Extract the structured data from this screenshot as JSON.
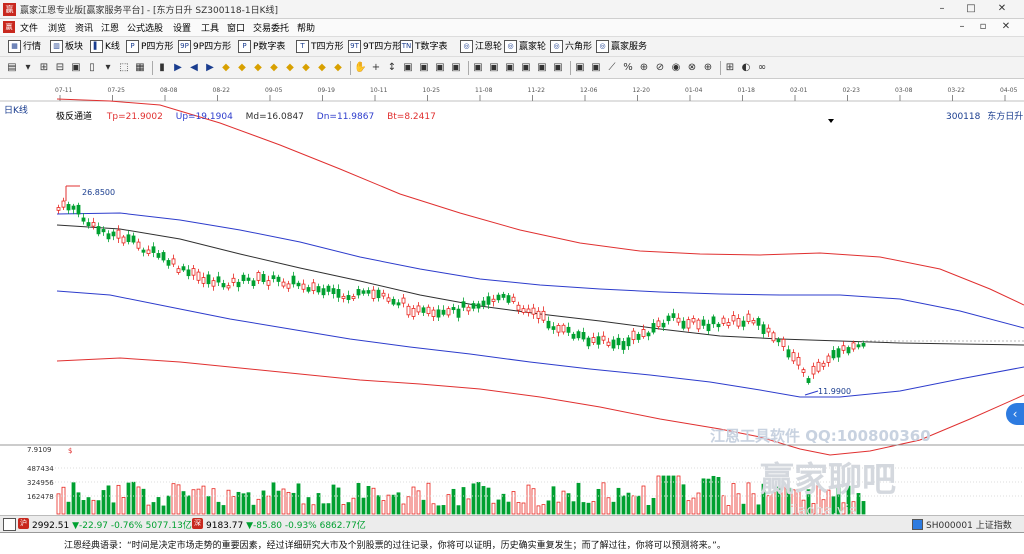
{
  "window": {
    "title": "赢家江恩专业版[赢家服务平台] - [东方日升  SZ300118-1日K线]",
    "logo": "赢"
  },
  "menu": {
    "items": [
      "文件",
      "浏览",
      "资讯",
      "江恩",
      "公式选股",
      "设置",
      "工具",
      "窗口",
      "交易委托",
      "帮助"
    ]
  },
  "toolbar": {
    "items": [
      {
        "icon": "▦",
        "label": "行情"
      },
      {
        "icon": "▥",
        "label": "板块"
      },
      {
        "icon": "▌",
        "label": "K线"
      },
      {
        "icon": "P",
        "label": "P四方形"
      },
      {
        "icon": "9P",
        "label": "9P四方形"
      },
      {
        "icon": "P",
        "label": "P数字表"
      },
      {
        "icon": "T",
        "label": "T四方形"
      },
      {
        "icon": "9T",
        "label": "9T四方形"
      },
      {
        "icon": "TN",
        "label": "T数字表"
      },
      {
        "icon": "◎",
        "label": "江恩轮"
      },
      {
        "icon": "◎",
        "label": "赢家轮"
      },
      {
        "icon": "◎",
        "label": "六角形"
      },
      {
        "icon": "◎",
        "label": "赢家服务"
      }
    ]
  },
  "chart": {
    "period_label": "日K线",
    "indicator_name": "极反通道",
    "tp": "Tp=21.9002",
    "up": "Up=19.1904",
    "md": "Md=16.0847",
    "dn": "Dn=11.9867",
    "bt": "Bt=8.2417",
    "code": "300118",
    "name": "东方日升",
    "high_marker": "26.8500",
    "low_marker": "11.9900",
    "volume_top": "7.9109",
    "volume_unit": "$",
    "volume_ticks": [
      "487434",
      "324956",
      "162478"
    ],
    "dates": [
      "07-11",
      "07-25",
      "08-08",
      "08-22",
      "09-05",
      "09-19",
      "10-11",
      "10-25",
      "11-08",
      "11-22",
      "12-06",
      "12-20",
      "01-04",
      "01-18",
      "02-01",
      "02-23",
      "03-08",
      "03-22",
      "04-05"
    ],
    "watermark1": "江恩工具软件  QQ:100800360",
    "watermark2": "赢家聊吧",
    "watermark3": "jiaoba.yjs"
  },
  "colors": {
    "up": "#e8251e",
    "down": "#00a030",
    "upper_band": "#e03030",
    "mid_band": "#303030",
    "lower_band": "#2d3ccc"
  },
  "chart_data": {
    "type": "candlestick",
    "x_dates": [
      "07-11",
      "07-25",
      "08-08",
      "08-22",
      "09-05",
      "09-19",
      "10-11",
      "10-25",
      "11-08",
      "11-22",
      "12-06",
      "12-20",
      "01-04",
      "01-18",
      "02-01",
      "02-23"
    ],
    "close_approx": [
      25.8,
      23.6,
      22.3,
      20.8,
      20.3,
      19.8,
      19.2,
      19.5,
      19.8,
      18.7,
      17.6,
      17.9,
      18.7,
      18.4,
      15.3,
      16.6
    ],
    "channel": {
      "tp": 21.9002,
      "up": 19.1904,
      "md": 16.0847,
      "dn": 11.9867,
      "bt": 8.2417
    },
    "high": 26.85,
    "low": 11.99
  },
  "status": {
    "idx1": "2992.51",
    "idx1_chg": "▼-22.97 -0.76% 5077.13亿",
    "idx2": "9183.77",
    "idx2_chg": "▼-85.80 -0.93% 6862.77亿",
    "right": "SH000001 上证指数"
  },
  "quote": {
    "text": "江恩经典语录：“时间是决定市场走势的重要因素，经过详细研究大市及个别股票的过往记录，你将可以证明，历史确实重复发生；而了解过往，你将可以预测将来。”。"
  }
}
